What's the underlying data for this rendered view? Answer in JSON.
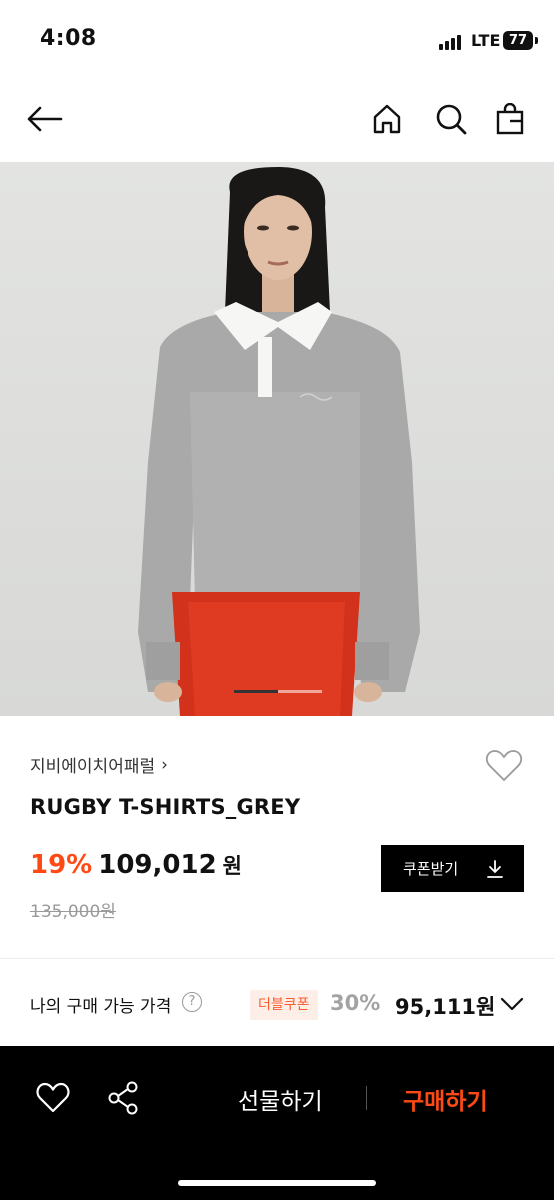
{
  "status_bar": {
    "time": "4:08",
    "network": "LTE",
    "battery": "77"
  },
  "nav": {
    "icons": [
      "back-arrow-icon",
      "home-icon",
      "search-icon",
      "shopping-bag-icon"
    ]
  },
  "hero": {
    "image_count_pages": 2,
    "current_page": 1
  },
  "product": {
    "brand": "지비에이치어패럴",
    "title": "RUGBY T-SHIRTS_GREY",
    "discount": "19%",
    "price": "109,012",
    "price_unit": "원",
    "original_price": "135,000원",
    "coupon_button": "쿠폰받기"
  },
  "my_price": {
    "label": "나의 구매 가능 가격",
    "help": "?",
    "badge": "더블쿠폰",
    "discount": "30%",
    "price": "95,111원"
  },
  "bottom_bar": {
    "gift_label": "선물하기",
    "buy_label": "구매하기"
  },
  "colors": {
    "accent": "#ff4a14",
    "badge_bg": "#fdeee8",
    "bottom_bar_bg": "#000000"
  }
}
